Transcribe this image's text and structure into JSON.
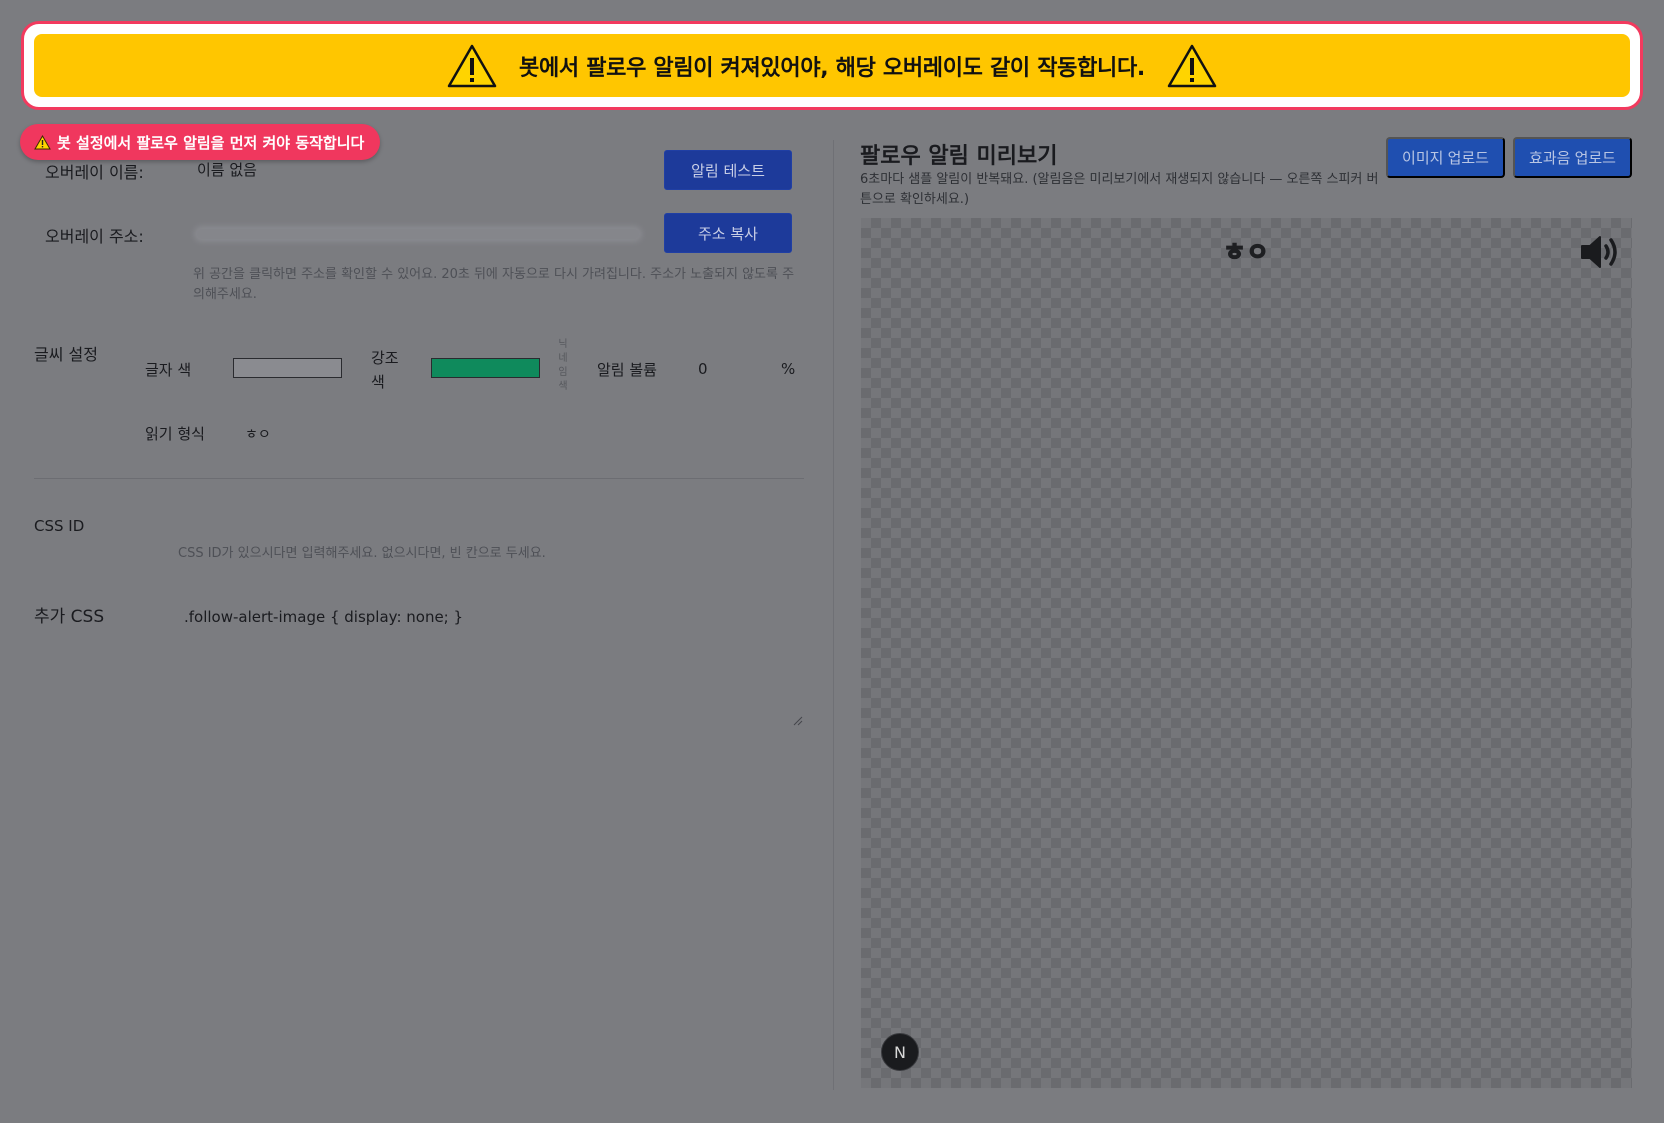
{
  "banner": {
    "message": "봇에서 팔로우 알림이 켜져있어야, 해당 오버레이도 같이 작동합니다."
  },
  "notice_pill": {
    "text": "봇 설정에서 팔로우 알림을 먼저 켜야 동작합니다"
  },
  "overlay": {
    "name_label": "오버레이 이름:",
    "name_value": "이름 없음",
    "test_button": "알림 테스트",
    "address_label": "오버레이 주소:",
    "copy_button": "주소 복사",
    "address_hint": "위 공간을 클릭하면 주소를 확인할 수 있어요. 20초 뒤에 자동으로 다시 가려집니다. 주소가 노출되지 않도록 주의해주세요."
  },
  "text_settings": {
    "section_label": "글씨 설정",
    "text_color_label": "글자 색",
    "text_color": "#8a8b90",
    "accent_color_label_1": "강조",
    "accent_color_label_2": "색",
    "accent_color": "#0f8a5c",
    "nickname_color_label": [
      "닉",
      "네",
      "임",
      "색"
    ],
    "volume_label": "알림 볼륨",
    "volume_value": "0",
    "volume_unit": "%",
    "reading_format_label": "읽기 형식",
    "reading_format_value": "ㅎㅇ"
  },
  "css": {
    "id_label": "CSS ID",
    "id_hint": "CSS ID가 있으시다면 입력해주세요. 없으시다면, 빈 칸으로 두세요.",
    "extra_label": "추가 CSS",
    "extra_value": ".follow-alert-image { display: none; }"
  },
  "preview": {
    "title": "팔로우 알림 미리보기",
    "description": "6초마다 샘플 알림이 반복돼요. (알림음은 미리보기에서 재생되지 않습니다 — 오른쪽 스피커 버튼으로 확인하세요.)",
    "image_upload_button": "이미지 업로드",
    "sound_upload_button": "효과음 업로드",
    "sample_text": "ㅎㅇ",
    "badge_letter": "N"
  },
  "colors": {
    "banner_yellow": "#ffc600",
    "alert_red": "#f0375e",
    "button_navy": "#1d3a9a",
    "button_blue": "#1f4fb0"
  },
  "icons": {
    "banner_left": "warning-triangle-icon",
    "banner_right": "warning-triangle-icon",
    "pill": "warning-triangle-icon",
    "speaker": "speaker-icon"
  }
}
